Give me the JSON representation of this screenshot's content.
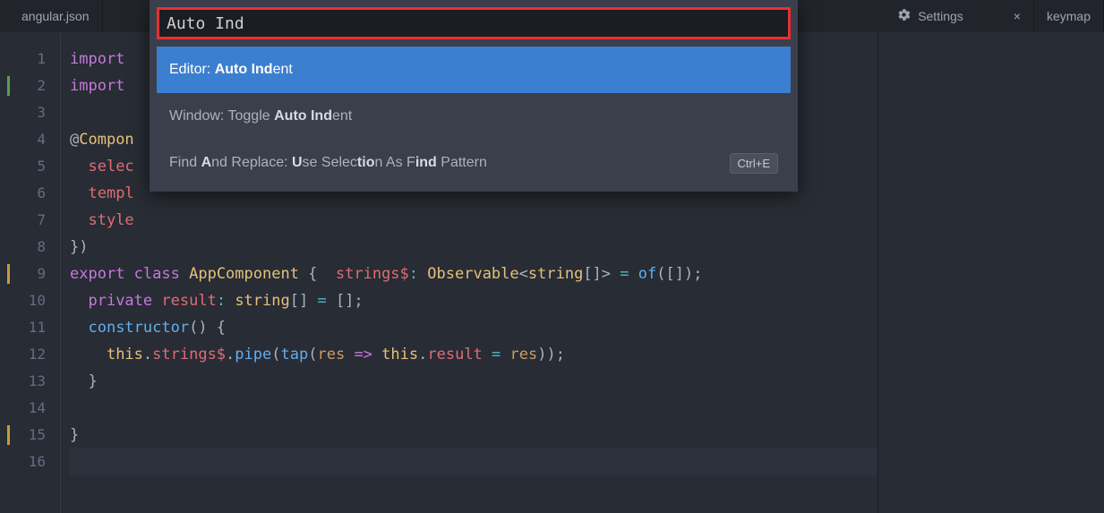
{
  "tabs": {
    "left": [
      {
        "label": "angular.json"
      }
    ],
    "right": [
      {
        "label": "Settings",
        "icon": "settings-icon",
        "closable": true
      },
      {
        "label": "keymap"
      }
    ]
  },
  "palette": {
    "query": "Auto Ind",
    "items": [
      {
        "display_parts": [
          "Editor: ",
          "Auto Ind",
          "ent"
        ],
        "selected": true
      },
      {
        "display_parts": [
          "Window: Toggle ",
          "Auto Ind",
          "ent"
        ],
        "selected": false
      },
      {
        "display_parts": [
          "Find ",
          "A",
          "nd Replace: ",
          "U",
          "se Selec",
          "tio",
          "n As F",
          "ind",
          " Pattern"
        ],
        "selected": false,
        "shortcut": "Ctrl+E"
      }
    ]
  },
  "gutter": {
    "start": 1,
    "end": 16,
    "marks": {
      "2": "green",
      "9": "orange",
      "15": "orange"
    },
    "active": 16
  },
  "code_lines": [
    [
      [
        "kw",
        "import"
      ],
      [
        "pun",
        " "
      ]
    ],
    [
      [
        "kw",
        "import"
      ],
      [
        "pun",
        " "
      ]
    ],
    [],
    [
      [
        "pun",
        "@"
      ],
      [
        "cls",
        "Compon"
      ]
    ],
    [
      [
        "pun",
        "  "
      ],
      [
        "prop",
        "selec"
      ]
    ],
    [
      [
        "pun",
        "  "
      ],
      [
        "prop",
        "templ"
      ]
    ],
    [
      [
        "pun",
        "  "
      ],
      [
        "prop",
        "style"
      ]
    ],
    [
      [
        "pun",
        "})"
      ]
    ],
    [
      [
        "kw",
        "export"
      ],
      [
        "pun",
        " "
      ],
      [
        "kw",
        "class"
      ],
      [
        "pun",
        " "
      ],
      [
        "cls",
        "AppComponent"
      ],
      [
        "pun",
        " {  "
      ],
      [
        "prop",
        "strings$"
      ],
      [
        "op",
        ":"
      ],
      [
        "pun",
        " "
      ],
      [
        "cls",
        "Observable"
      ],
      [
        "pun",
        "<"
      ],
      [
        "cls",
        "string"
      ],
      [
        "pun",
        "[]> "
      ],
      [
        "op",
        "="
      ],
      [
        "pun",
        " "
      ],
      [
        "fn",
        "of"
      ],
      [
        "pun",
        "([]);"
      ]
    ],
    [
      [
        "pun",
        "  "
      ],
      [
        "kw",
        "private"
      ],
      [
        "pun",
        " "
      ],
      [
        "prop",
        "result"
      ],
      [
        "op",
        ":"
      ],
      [
        "pun",
        " "
      ],
      [
        "cls",
        "string"
      ],
      [
        "pun",
        "[] "
      ],
      [
        "op",
        "="
      ],
      [
        "pun",
        " [];"
      ]
    ],
    [
      [
        "pun",
        "  "
      ],
      [
        "fn",
        "constructor"
      ],
      [
        "pun",
        "() {"
      ]
    ],
    [
      [
        "pun",
        "    "
      ],
      [
        "this",
        "this"
      ],
      [
        "pun",
        "."
      ],
      [
        "prop",
        "strings$"
      ],
      [
        "pun",
        "."
      ],
      [
        "fn",
        "pipe"
      ],
      [
        "pun",
        "("
      ],
      [
        "fn",
        "tap"
      ],
      [
        "pun",
        "("
      ],
      [
        "param",
        "res"
      ],
      [
        "pun",
        " "
      ],
      [
        "kw",
        "=>"
      ],
      [
        "pun",
        " "
      ],
      [
        "this",
        "this"
      ],
      [
        "pun",
        "."
      ],
      [
        "prop",
        "result"
      ],
      [
        "pun",
        " "
      ],
      [
        "op",
        "="
      ],
      [
        "pun",
        " "
      ],
      [
        "param",
        "res"
      ],
      [
        "pun",
        "));"
      ]
    ],
    [
      [
        "pun",
        "  }"
      ]
    ],
    [],
    [
      [
        "pun",
        "}"
      ]
    ],
    []
  ]
}
